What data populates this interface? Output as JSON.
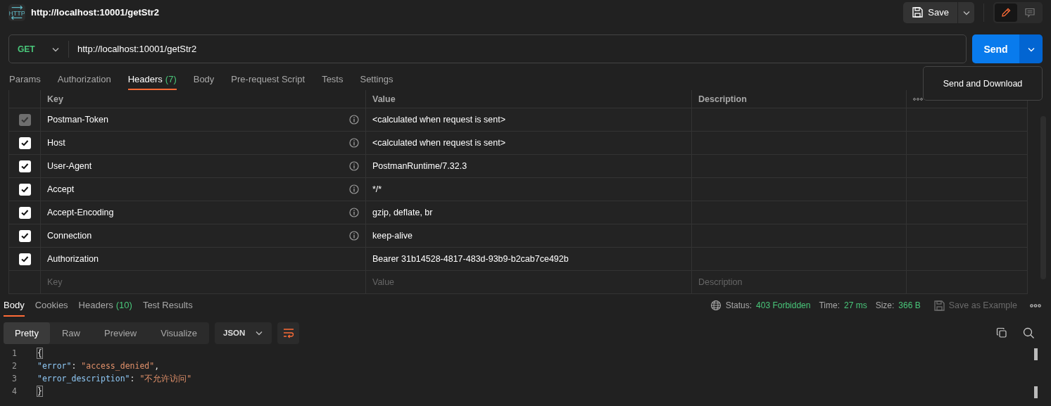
{
  "request_tab": {
    "icon_label": "HTTP",
    "title": "http://localhost:10001/getStr2"
  },
  "toolbar": {
    "save": "Save",
    "modes": [
      {
        "kind": "edit",
        "selected": true
      },
      {
        "kind": "comments",
        "selected": false
      }
    ]
  },
  "url_bar": {
    "method": "GET",
    "url": "http://localhost:10001/getStr2",
    "send": "Send"
  },
  "send_menu": {
    "items": [
      "Send and Download"
    ]
  },
  "request_tabs": [
    {
      "label": "Params",
      "selected": false
    },
    {
      "label": "Authorization",
      "selected": false
    },
    {
      "label": "Headers",
      "count": "(7)",
      "selected": true
    },
    {
      "label": "Body",
      "selected": false
    },
    {
      "label": "Pre-request Script",
      "selected": false
    },
    {
      "label": "Tests",
      "selected": false
    },
    {
      "label": "Settings",
      "selected": false
    }
  ],
  "headers_table": {
    "columns": [
      "Key",
      "Value",
      "Description"
    ],
    "rows": [
      {
        "checked": true,
        "disabled": true,
        "info": true,
        "key": "Postman-Token",
        "value": "<calculated when request is sent>"
      },
      {
        "checked": true,
        "disabled": false,
        "info": true,
        "key": "Host",
        "value": "<calculated when request is sent>"
      },
      {
        "checked": true,
        "disabled": false,
        "info": true,
        "key": "User-Agent",
        "value": "PostmanRuntime/7.32.3"
      },
      {
        "checked": true,
        "disabled": false,
        "info": true,
        "key": "Accept",
        "value": "*/*"
      },
      {
        "checked": true,
        "disabled": false,
        "info": true,
        "key": "Accept-Encoding",
        "value": "gzip, deflate, br"
      },
      {
        "checked": true,
        "disabled": false,
        "info": true,
        "key": "Connection",
        "value": "keep-alive"
      },
      {
        "checked": true,
        "disabled": false,
        "info": false,
        "key": "Authorization",
        "value": "Bearer 31b14528-4817-483d-93b9-b2cab7ce492b"
      }
    ],
    "new_row": {
      "key_placeholder": "Key",
      "value_placeholder": "Value",
      "description_placeholder": "Description"
    }
  },
  "response_tabs": [
    {
      "label": "Body",
      "selected": true
    },
    {
      "label": "Cookies",
      "selected": false
    },
    {
      "label": "Headers",
      "count": "(10)",
      "selected": false
    },
    {
      "label": "Test Results",
      "selected": false
    }
  ],
  "response_meta": [
    {
      "label": "Status:",
      "value": "403 Forbidden"
    },
    {
      "label": "Time:",
      "value": "27 ms"
    },
    {
      "label": "Size:",
      "value": "366 B"
    }
  ],
  "save_example": {
    "label": "Save as Example",
    "disabled": true
  },
  "view_modes": [
    {
      "label": "Pretty",
      "selected": true
    },
    {
      "label": "Raw",
      "selected": false
    },
    {
      "label": "Preview",
      "selected": false
    },
    {
      "label": "Visualize",
      "selected": false
    }
  ],
  "format": "JSON",
  "code": [
    {
      "number": "1",
      "tokens": [
        {
          "kind": "bracket",
          "text": "{",
          "highlighted": true
        }
      ]
    },
    {
      "number": "2",
      "tokens": [
        {
          "kind": "key",
          "text": "\"error\""
        },
        {
          "kind": "punct",
          "text": ": "
        },
        {
          "kind": "string",
          "text": "\"access_denied\""
        },
        {
          "kind": "punct",
          "text": ","
        }
      ]
    },
    {
      "number": "3",
      "tokens": [
        {
          "kind": "key",
          "text": "\"error_description\""
        },
        {
          "kind": "punct",
          "text": ": "
        },
        {
          "kind": "string",
          "text": "\"不允许访问\""
        }
      ]
    },
    {
      "number": "4",
      "tokens": [
        {
          "kind": "bracket",
          "text": "}",
          "highlighted": true
        }
      ]
    }
  ]
}
